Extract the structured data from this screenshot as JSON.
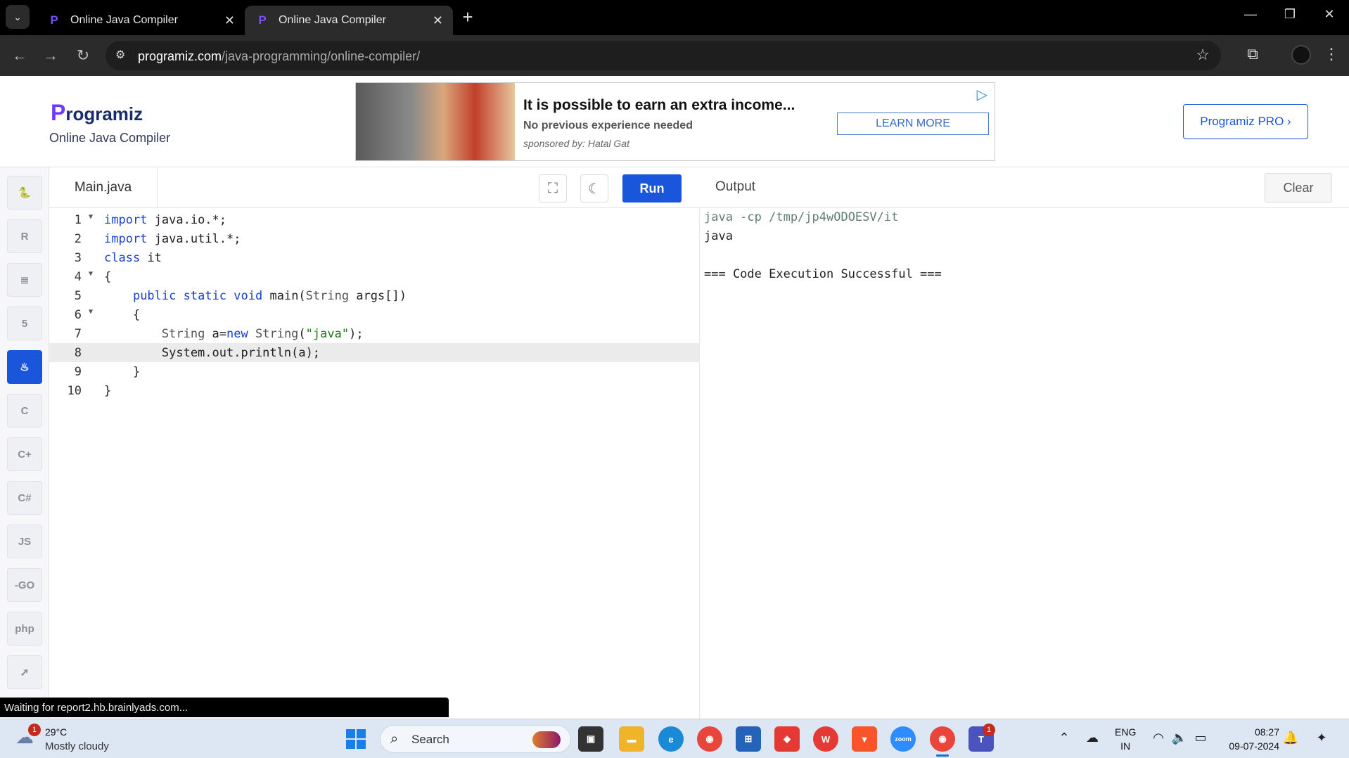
{
  "browser": {
    "tabs": [
      {
        "title": "Online Java Compiler",
        "active": false
      },
      {
        "title": "Online Java Compiler",
        "active": true
      }
    ],
    "url_host": "programiz.com",
    "url_path": "/java-programming/online-compiler/"
  },
  "header": {
    "logo_text": "rogramiz",
    "logo_p": "P",
    "subtitle": "Online Java Compiler",
    "pro_button": "Programiz PRO ›"
  },
  "ad": {
    "title": "It is possible to earn an extra income...",
    "subtitle": "No previous experience needed",
    "sponsor": "sponsored by: Hatal Gat",
    "button": "LEARN MORE"
  },
  "sidebar": {
    "languages": [
      {
        "name": "python",
        "glyph": "🐍",
        "active": false
      },
      {
        "name": "r",
        "glyph": "R",
        "active": false
      },
      {
        "name": "sql",
        "glyph": "≣",
        "active": false
      },
      {
        "name": "html",
        "glyph": "5",
        "active": false
      },
      {
        "name": "java",
        "glyph": "♨",
        "active": true
      },
      {
        "name": "c",
        "glyph": "C",
        "active": false
      },
      {
        "name": "cpp",
        "glyph": "C+",
        "active": false
      },
      {
        "name": "csharp",
        "glyph": "C#",
        "active": false
      },
      {
        "name": "javascript",
        "glyph": "JS",
        "active": false
      },
      {
        "name": "go",
        "glyph": "-GO",
        "active": false
      },
      {
        "name": "php",
        "glyph": "php",
        "active": false
      },
      {
        "name": "swift",
        "glyph": "➚",
        "active": false
      }
    ]
  },
  "editor": {
    "file_name": "Main.java",
    "run_label": "Run",
    "highlighted_line": 8,
    "lines": [
      {
        "num": "1",
        "fold": true,
        "text": "import java.io.*;"
      },
      {
        "num": "2",
        "fold": false,
        "text": "import java.util.*;"
      },
      {
        "num": "3",
        "fold": false,
        "text": "class it"
      },
      {
        "num": "4",
        "fold": true,
        "text": "{"
      },
      {
        "num": "5",
        "fold": false,
        "text": "    public static void main(String args[])"
      },
      {
        "num": "6",
        "fold": true,
        "text": "    {"
      },
      {
        "num": "7",
        "fold": false,
        "text": "        String a=new String(\"java\");"
      },
      {
        "num": "8",
        "fold": false,
        "text": "        System.out.println(a);"
      },
      {
        "num": "9",
        "fold": false,
        "text": "    }"
      },
      {
        "num": "10",
        "fold": false,
        "text": "}"
      }
    ]
  },
  "output": {
    "title": "Output",
    "clear_label": "Clear",
    "lines": [
      {
        "text": "java -cp /tmp/jp4wODOESV/it",
        "kind": "cmd"
      },
      {
        "text": "java",
        "kind": "out"
      },
      {
        "text": "",
        "kind": "out"
      },
      {
        "text": "=== Code Execution Successful ===",
        "kind": "out"
      }
    ]
  },
  "status_toast": "Waiting for report2.hb.brainlyads.com...",
  "taskbar": {
    "weather_temp": "29°C",
    "weather_condition": "Mostly cloudy",
    "weather_badge": "1",
    "search_label": "Search",
    "language_line1": "ENG",
    "language_line2": "IN",
    "time": "08:27",
    "date": "09-07-2024",
    "teams_badge": "1",
    "apps": [
      "task-view",
      "file-explorer",
      "edge",
      "chrome",
      "microsoft-store",
      "anydesk",
      "wps-office",
      "brave",
      "zoom",
      "chrome-active",
      "teams"
    ]
  },
  "colors": {
    "accent": "#1a56db",
    "brand_purple": "#6b3bff"
  }
}
